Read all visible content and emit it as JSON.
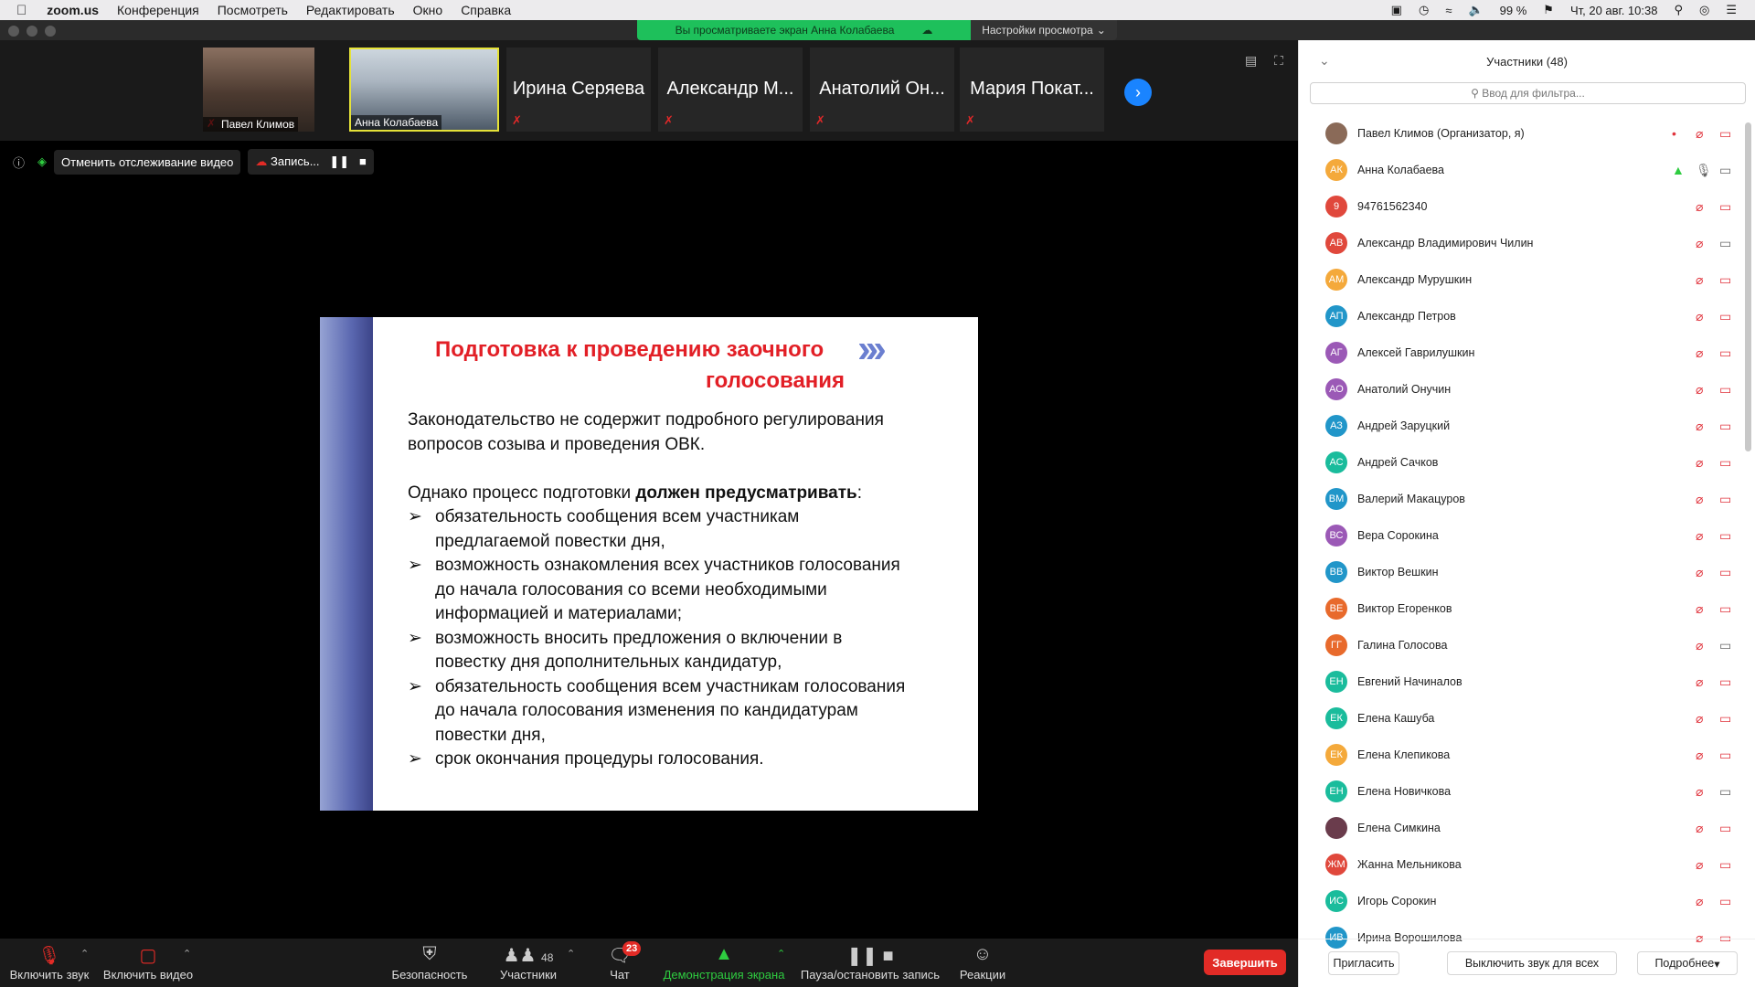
{
  "macbar": {
    "app": "zoom.us",
    "menus": [
      "Конференция",
      "Посмотреть",
      "Редактировать",
      "Окно",
      "Справка"
    ],
    "battery": "99 %",
    "datetime": "Чт, 20 авг.  10:38"
  },
  "banner": {
    "sharing": "Вы просматриваете экран Анна Колабаева",
    "view_options": "Настройки просмотра"
  },
  "strip": {
    "video_tiles": [
      "Павел Климов",
      "Анна Колабаева"
    ],
    "name_tiles": [
      "Ирина Серяева",
      "Александр М...",
      "Анатолий Он...",
      "Мария Покат..."
    ]
  },
  "recbar": {
    "stop_follow": "Отменить отслеживание видео",
    "recording": "Запись..."
  },
  "slide": {
    "title_line1": "Подготовка  к проведению  заочного",
    "title_line2": "голосования",
    "para1_line1": "Законодательство не содержит подробного регулирования",
    "para1_line2": "вопросов созыва и проведения ОВК.",
    "para2_prefix": "Однако процесс  подготовки ",
    "para2_bold": "должен предусматривать",
    "para2_suffix": ":",
    "bullets": [
      {
        "l1": "обязательность сообщения всем участникам",
        "l2": "предлагаемой повестки дня,",
        "l3": ""
      },
      {
        "l1": " возможность ознакомления всех участников голосования",
        "l2": "до начала голосования со всеми необходимыми",
        "l3": "информацией и материалами;"
      },
      {
        "l1": " возможность вносить предложения о включении в",
        "l2": "повестку дня дополнительных кандидатур,",
        "l3": ""
      },
      {
        "l1": " обязательность сообщения всем участникам голосования",
        "l2": "до начала голосования изменения по кандидатурам",
        "l3": "повестки дня,"
      },
      {
        "l1": " срок окончания процедуры голосования.",
        "l2": "",
        "l3": ""
      }
    ]
  },
  "panel": {
    "title": "Участники (48)",
    "filter_placeholder": "Ввод для фильтра...",
    "participants": [
      {
        "initials": "",
        "name": "Павел Климов (Организатор, я)",
        "color": "#8a6a58"
      },
      {
        "initials": "АК",
        "name": "Анна Колабаева",
        "color": "#f4a93b"
      },
      {
        "initials": "9",
        "name": "94761562340",
        "color": "#e0483c"
      },
      {
        "initials": "АВ",
        "name": "Александр Владимирович Чилин",
        "color": "#e0483c"
      },
      {
        "initials": "АМ",
        "name": "Александр Мурушкин",
        "color": "#f4a93b"
      },
      {
        "initials": "АП",
        "name": "Александр Петров",
        "color": "#2196c9"
      },
      {
        "initials": "АГ",
        "name": "Алексей Гаврилушкин",
        "color": "#9b59b6"
      },
      {
        "initials": "АО",
        "name": "Анатолий Онучин",
        "color": "#9b59b6"
      },
      {
        "initials": "АЗ",
        "name": "Андрей Заруцкий",
        "color": "#2196c9"
      },
      {
        "initials": "АС",
        "name": "Андрей Сачков",
        "color": "#1abc9c"
      },
      {
        "initials": "ВМ",
        "name": "Валерий Макацуров",
        "color": "#2196c9"
      },
      {
        "initials": "ВС",
        "name": "Вера Сорокина",
        "color": "#9b59b6"
      },
      {
        "initials": "ВВ",
        "name": "Виктор Вешкин",
        "color": "#2196c9"
      },
      {
        "initials": "ВЕ",
        "name": "Виктор Егоренков",
        "color": "#e86a2c"
      },
      {
        "initials": "ГГ",
        "name": "Галина Голосова",
        "color": "#e86a2c"
      },
      {
        "initials": "ЕН",
        "name": "Евгений Начиналов",
        "color": "#1abc9c"
      },
      {
        "initials": "ЕК",
        "name": "Елена Кашуба",
        "color": "#1abc9c"
      },
      {
        "initials": "ЕК",
        "name": "Елена Клепикова",
        "color": "#f4a93b"
      },
      {
        "initials": "ЕН",
        "name": "Елена Новичкова",
        "color": "#1abc9c"
      },
      {
        "initials": "",
        "name": "Елена Симкина",
        "color": "#6a3c4c"
      },
      {
        "initials": "ЖМ",
        "name": "Жанна Мельникова",
        "color": "#e0483c"
      },
      {
        "initials": "ИС",
        "name": "Игорь Сорокин",
        "color": "#1abc9c"
      },
      {
        "initials": "ИВ",
        "name": "Ирина Ворошилова",
        "color": "#2196c9"
      }
    ],
    "invite": "Пригласить",
    "mute_all": "Выключить звук для всех",
    "more": "Подробнее"
  },
  "toolbar": {
    "unmute": "Включить звук",
    "start_video": "Включить видео",
    "security": "Безопасность",
    "participants": "Участники",
    "participants_count": "48",
    "chat": "Чат",
    "chat_badge": "23",
    "share": "Демонстрация экрана",
    "pause_rec": "Пауза/остановить запись",
    "reactions": "Реакции",
    "end": "Завершить"
  }
}
